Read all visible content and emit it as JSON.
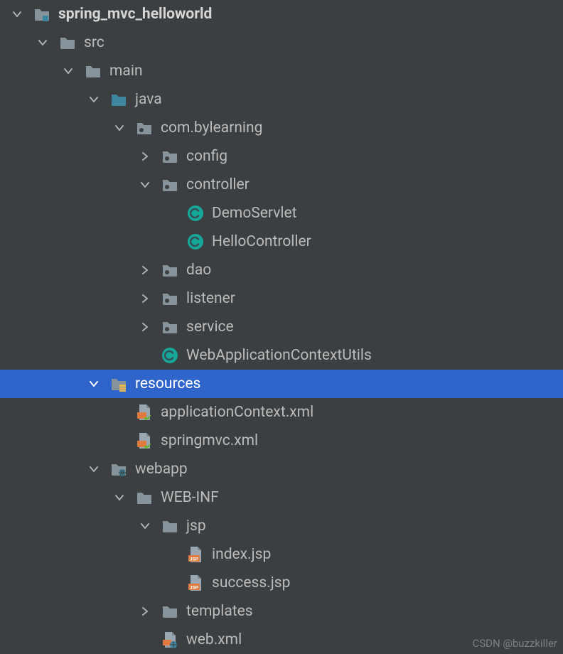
{
  "colors": {
    "background": "#3c3f41",
    "text": "#bbbbbb",
    "textBold": "#d5d5d5",
    "selectedBg": "#2f65ca",
    "selectedText": "#ffffff",
    "arrow": "#aeb0b2",
    "folderGray": "#87939a",
    "folderBlue": "#3e86a0",
    "classBadge": "#15a89a",
    "classLetter": "#365057",
    "springGreen": "#6db33f",
    "springOrange": "#e27a3f",
    "jspOrange": "#e27a3f",
    "fileGray": "#9aa7b0",
    "watermark": "#9a9a9a"
  },
  "indentUnit": 36,
  "baseIndent": 12,
  "watermark": "CSDN @buzzkiller",
  "nodes": [
    {
      "depth": 0,
      "arrow": "down",
      "icon": "module",
      "label": "spring_mvc_helloworld",
      "bold": true,
      "selected": false,
      "interactable": true
    },
    {
      "depth": 1,
      "arrow": "down",
      "icon": "folder-gray",
      "label": "src",
      "bold": false,
      "selected": false,
      "interactable": true
    },
    {
      "depth": 2,
      "arrow": "down",
      "icon": "folder-gray",
      "label": "main",
      "bold": false,
      "selected": false,
      "interactable": true
    },
    {
      "depth": 3,
      "arrow": "down",
      "icon": "folder-blue",
      "label": "java",
      "bold": false,
      "selected": false,
      "interactable": true
    },
    {
      "depth": 4,
      "arrow": "down",
      "icon": "package",
      "label": "com.bylearning",
      "bold": false,
      "selected": false,
      "interactable": true
    },
    {
      "depth": 5,
      "arrow": "right",
      "icon": "package",
      "label": "config",
      "bold": false,
      "selected": false,
      "interactable": true
    },
    {
      "depth": 5,
      "arrow": "down",
      "icon": "package",
      "label": "controller",
      "bold": false,
      "selected": false,
      "interactable": true
    },
    {
      "depth": 6,
      "arrow": "none",
      "icon": "class",
      "label": "DemoServlet",
      "bold": false,
      "selected": false,
      "interactable": true
    },
    {
      "depth": 6,
      "arrow": "none",
      "icon": "class",
      "label": "HelloController",
      "bold": false,
      "selected": false,
      "interactable": true
    },
    {
      "depth": 5,
      "arrow": "right",
      "icon": "package",
      "label": "dao",
      "bold": false,
      "selected": false,
      "interactable": true
    },
    {
      "depth": 5,
      "arrow": "right",
      "icon": "package",
      "label": "listener",
      "bold": false,
      "selected": false,
      "interactable": true
    },
    {
      "depth": 5,
      "arrow": "right",
      "icon": "package",
      "label": "service",
      "bold": false,
      "selected": false,
      "interactable": true
    },
    {
      "depth": 5,
      "arrow": "none",
      "icon": "class",
      "label": "WebApplicationContextUtils",
      "bold": false,
      "selected": false,
      "interactable": true
    },
    {
      "depth": 3,
      "arrow": "down",
      "icon": "resources",
      "label": "resources",
      "bold": false,
      "selected": true,
      "interactable": true
    },
    {
      "depth": 4,
      "arrow": "none",
      "icon": "spring-xml",
      "label": "applicationContext.xml",
      "bold": false,
      "selected": false,
      "interactable": true
    },
    {
      "depth": 4,
      "arrow": "none",
      "icon": "spring-xml",
      "label": "springmvc.xml",
      "bold": false,
      "selected": false,
      "interactable": true
    },
    {
      "depth": 3,
      "arrow": "down",
      "icon": "folder-web",
      "label": "webapp",
      "bold": false,
      "selected": false,
      "interactable": true
    },
    {
      "depth": 4,
      "arrow": "down",
      "icon": "folder-gray",
      "label": "WEB-INF",
      "bold": false,
      "selected": false,
      "interactable": true
    },
    {
      "depth": 5,
      "arrow": "down",
      "icon": "folder-gray",
      "label": "jsp",
      "bold": false,
      "selected": false,
      "interactable": true
    },
    {
      "depth": 6,
      "arrow": "none",
      "icon": "jsp",
      "label": "index.jsp",
      "bold": false,
      "selected": false,
      "interactable": true
    },
    {
      "depth": 6,
      "arrow": "none",
      "icon": "jsp",
      "label": "success.jsp",
      "bold": false,
      "selected": false,
      "interactable": true
    },
    {
      "depth": 5,
      "arrow": "right",
      "icon": "folder-gray",
      "label": "templates",
      "bold": false,
      "selected": false,
      "interactable": true
    },
    {
      "depth": 5,
      "arrow": "none",
      "icon": "web-xml",
      "label": "web.xml",
      "bold": false,
      "selected": false,
      "interactable": true
    }
  ]
}
